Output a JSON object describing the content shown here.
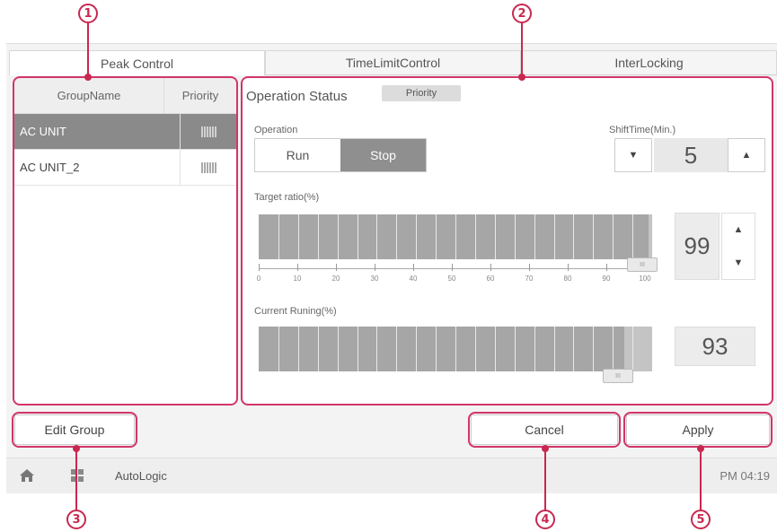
{
  "callouts": {
    "c1": "1",
    "c2": "2",
    "c3": "3",
    "c4": "4",
    "c5": "5"
  },
  "tabs": [
    "Peak Control",
    "TimeLimitControl",
    "InterLocking"
  ],
  "group_list": {
    "header_name": "GroupName",
    "header_priority": "Priority",
    "rows": [
      "AC UNIT",
      "AC UNIT_2"
    ]
  },
  "panel": {
    "operation_status_label": "Operation Status",
    "priority_badge": "Priority",
    "operation_label": "Operation",
    "run_label": "Run",
    "stop_label": "Stop",
    "shift_label": "ShiftTime(Min.)",
    "shift_value": "5",
    "target_label": "Target ratio(%)",
    "target_value": "99",
    "scale_labels": [
      "0",
      "10",
      "20",
      "30",
      "40",
      "50",
      "60",
      "70",
      "80",
      "90",
      "100"
    ],
    "current_label": "Current Runing(%)",
    "current_value": "93"
  },
  "buttons": {
    "edit_group": "Edit Group",
    "cancel": "Cancel",
    "apply": "Apply"
  },
  "status": {
    "app_label": "AutoLogic",
    "time": "PM 04:19"
  },
  "colors": {
    "accent": "#c8284f",
    "selected_row": "#8a8a8a"
  }
}
